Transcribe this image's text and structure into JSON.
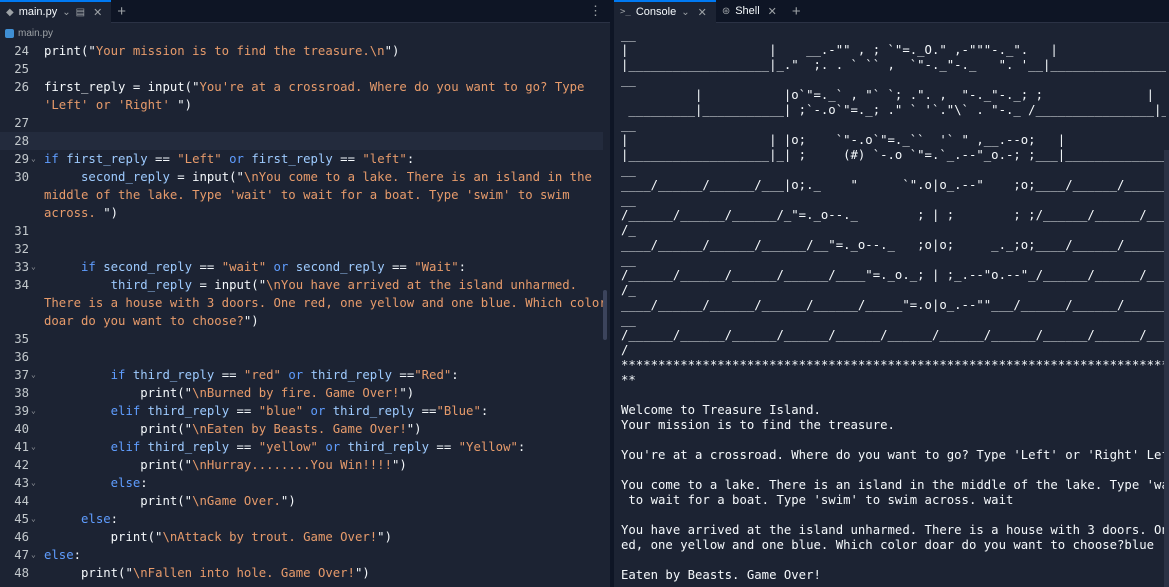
{
  "editor": {
    "tab_label": "main.py",
    "breadcrumb": "main.py",
    "lines": [
      {
        "n": "24",
        "fold": false,
        "indent": "",
        "html": [
          [
            "plain",
            "print(\""
          ],
          [
            "str",
            "Your mission is to find the treasure.\\n"
          ],
          [
            "plain",
            "\")"
          ]
        ]
      },
      {
        "n": "25",
        "fold": false,
        "indent": "",
        "html": []
      },
      {
        "n": "26",
        "fold": false,
        "indent": "",
        "html": [
          [
            "plain",
            "first_reply = input(\""
          ],
          [
            "str",
            "You're at a crossroad. Where do you want to go? Type"
          ]
        ]
      },
      {
        "n": "",
        "fold": false,
        "indent": "",
        "html": [
          [
            "str",
            "'Left' or 'Right' "
          ],
          [
            "plain",
            "\")"
          ]
        ]
      },
      {
        "n": "27",
        "fold": false,
        "indent": "",
        "html": []
      },
      {
        "n": "28",
        "fold": false,
        "indent": "",
        "html": [],
        "cursor": true
      },
      {
        "n": "29",
        "fold": true,
        "indent": "",
        "html": [
          [
            "kw",
            "if "
          ],
          [
            "var",
            "first_reply"
          ],
          [
            "plain",
            " == "
          ],
          [
            "str",
            "\"Left\""
          ],
          [
            "kw",
            " or "
          ],
          [
            "var",
            "first_reply"
          ],
          [
            "plain",
            " == "
          ],
          [
            "str",
            "\"left\""
          ],
          [
            "plain",
            ":"
          ]
        ]
      },
      {
        "n": "30",
        "fold": false,
        "indent": "     ",
        "html": [
          [
            "var",
            "second_reply"
          ],
          [
            "plain",
            " = input(\""
          ],
          [
            "str",
            "\\nYou come to a lake. There is an island in the"
          ]
        ]
      },
      {
        "n": "",
        "fold": false,
        "indent": "",
        "html": [
          [
            "str",
            "middle of the lake. Type 'wait' to wait for a boat. Type 'swim' to swim"
          ]
        ]
      },
      {
        "n": "",
        "fold": false,
        "indent": "",
        "html": [
          [
            "str",
            "across. "
          ],
          [
            "plain",
            "\")"
          ]
        ]
      },
      {
        "n": "31",
        "fold": false,
        "indent": "",
        "html": []
      },
      {
        "n": "32",
        "fold": false,
        "indent": "",
        "html": []
      },
      {
        "n": "33",
        "fold": true,
        "indent": "     ",
        "html": [
          [
            "kw",
            "if "
          ],
          [
            "var",
            "second_reply"
          ],
          [
            "plain",
            " == "
          ],
          [
            "str",
            "\"wait\""
          ],
          [
            "kw",
            " or "
          ],
          [
            "var",
            "second_reply"
          ],
          [
            "plain",
            " == "
          ],
          [
            "str",
            "\"Wait\""
          ],
          [
            "plain",
            ":"
          ]
        ]
      },
      {
        "n": "34",
        "fold": false,
        "indent": "         ",
        "html": [
          [
            "var",
            "third_reply"
          ],
          [
            "plain",
            " = input(\""
          ],
          [
            "str",
            "\\nYou have arrived at the island unharmed."
          ]
        ]
      },
      {
        "n": "",
        "fold": false,
        "indent": "",
        "html": [
          [
            "str",
            "There is a house with 3 doors. One red, one yellow and one blue. Which color"
          ]
        ]
      },
      {
        "n": "",
        "fold": false,
        "indent": "",
        "html": [
          [
            "str",
            "doar do you want to choose?"
          ],
          [
            "plain",
            "\")"
          ]
        ]
      },
      {
        "n": "35",
        "fold": false,
        "indent": "",
        "html": []
      },
      {
        "n": "36",
        "fold": false,
        "indent": "",
        "html": []
      },
      {
        "n": "37",
        "fold": true,
        "indent": "         ",
        "html": [
          [
            "kw",
            "if "
          ],
          [
            "var",
            "third_reply"
          ],
          [
            "plain",
            " == "
          ],
          [
            "str",
            "\"red\""
          ],
          [
            "kw",
            " or "
          ],
          [
            "var",
            "third_reply"
          ],
          [
            "plain",
            " =="
          ],
          [
            "str",
            "\"Red\""
          ],
          [
            "plain",
            ":"
          ]
        ]
      },
      {
        "n": "38",
        "fold": false,
        "indent": "             ",
        "html": [
          [
            "plain",
            "print(\""
          ],
          [
            "str",
            "\\nBurned by fire. Game Over!"
          ],
          [
            "plain",
            "\")"
          ]
        ]
      },
      {
        "n": "39",
        "fold": true,
        "indent": "         ",
        "html": [
          [
            "kw",
            "elif "
          ],
          [
            "var",
            "third_reply"
          ],
          [
            "plain",
            " == "
          ],
          [
            "str",
            "\"blue\""
          ],
          [
            "kw",
            " or "
          ],
          [
            "var",
            "third_reply"
          ],
          [
            "plain",
            " =="
          ],
          [
            "str",
            "\"Blue\""
          ],
          [
            "plain",
            ":"
          ]
        ]
      },
      {
        "n": "40",
        "fold": false,
        "indent": "             ",
        "html": [
          [
            "plain",
            "print(\""
          ],
          [
            "str",
            "\\nEaten by Beasts. Game Over!"
          ],
          [
            "plain",
            "\")"
          ]
        ]
      },
      {
        "n": "41",
        "fold": true,
        "indent": "         ",
        "html": [
          [
            "kw",
            "elif "
          ],
          [
            "var",
            "third_reply"
          ],
          [
            "plain",
            " == "
          ],
          [
            "str",
            "\"yellow\""
          ],
          [
            "kw",
            " or "
          ],
          [
            "var",
            "third_reply"
          ],
          [
            "plain",
            " == "
          ],
          [
            "str",
            "\"Yellow\""
          ],
          [
            "plain",
            ":"
          ]
        ]
      },
      {
        "n": "42",
        "fold": false,
        "indent": "             ",
        "html": [
          [
            "plain",
            "print(\""
          ],
          [
            "str",
            "\\nHurray........You Win!!!!"
          ],
          [
            "plain",
            "\")"
          ]
        ]
      },
      {
        "n": "43",
        "fold": true,
        "indent": "         ",
        "html": [
          [
            "kw",
            "else"
          ],
          [
            "plain",
            ":"
          ]
        ]
      },
      {
        "n": "44",
        "fold": false,
        "indent": "             ",
        "html": [
          [
            "plain",
            "print(\""
          ],
          [
            "str",
            "\\nGame Over."
          ],
          [
            "plain",
            "\")"
          ]
        ]
      },
      {
        "n": "45",
        "fold": true,
        "indent": "     ",
        "html": [
          [
            "kw",
            "else"
          ],
          [
            "plain",
            ":"
          ]
        ]
      },
      {
        "n": "46",
        "fold": false,
        "indent": "         ",
        "html": [
          [
            "plain",
            "print(\""
          ],
          [
            "str",
            "\\nAttack by trout. Game Over!"
          ],
          [
            "plain",
            "\")"
          ]
        ]
      },
      {
        "n": "47",
        "fold": true,
        "indent": "",
        "html": [
          [
            "kw",
            "else"
          ],
          [
            "plain",
            ":"
          ]
        ]
      },
      {
        "n": "48",
        "fold": false,
        "indent": "     ",
        "html": [
          [
            "plain",
            "print(\""
          ],
          [
            "str",
            "\\nFallen into hole. Game Over!"
          ],
          [
            "plain",
            "\")"
          ]
        ]
      }
    ]
  },
  "console": {
    "tab_console": "Console",
    "tab_shell": "Shell",
    "output": "__\n|                   |    __.-\"\" , ; `\"=._O.\" ,-\"\"\"-._\".   |\n|___________________|_.\"  ;. . ` `` ,  `\"-._\"-._   \". '__|___________________\n__\n          |           |o`\"=._` , \"` `; .\". ,  \"-._\"-._; ;              |\n _________|___________| ;`-.o`\"=._; .\" ` '`.\"\\` . \"-._ /________________|_____\n__\n|                   | |o;    `\"-.o`\"=._``  '` \" ,__.--o;   |\n|___________________|_| ;     (#) `-.o `\"=.`_.--\"_o.-; ;___|___________________\n__\n____/______/______/___|o;._    \"      `\".o|o_.--\"    ;o;____/______/______/____\n__\n/______/______/______/_\"=._o--._        ; | ;        ; ;/______/______/______/_\n/_\n____/______/______/______/__\"=._o--._   ;o|o;     _._;o;____/______/______/____\n__\n/______/______/______/______/____\"=._o._; | ;_.--\"o.--\"_/______/______/______/_\n/_\n____/______/______/______/______/_____\"=.o|o_.--\"\"___/______/______/______/____\n__\n/______/______/______/______/______/______/______/______/______/______/_______\n/\n*******************************************************************************\n**\n\nWelcome to Treasure Island.\nYour mission is to find the treasure.\n\nYou're at a crossroad. Where do you want to go? Type 'Left' or 'Right' Left\n\nYou come to a lake. There is an island in the middle of the lake. Type 'wait'\n to wait for a boat. Type 'swim' to swim across. wait\n\nYou have arrived at the island unharmed. There is a house with 3 doors. One r\ned, one yellow and one blue. Which color doar do you want to choose?blue\n\nEaten by Beasts. Game Over!"
  }
}
